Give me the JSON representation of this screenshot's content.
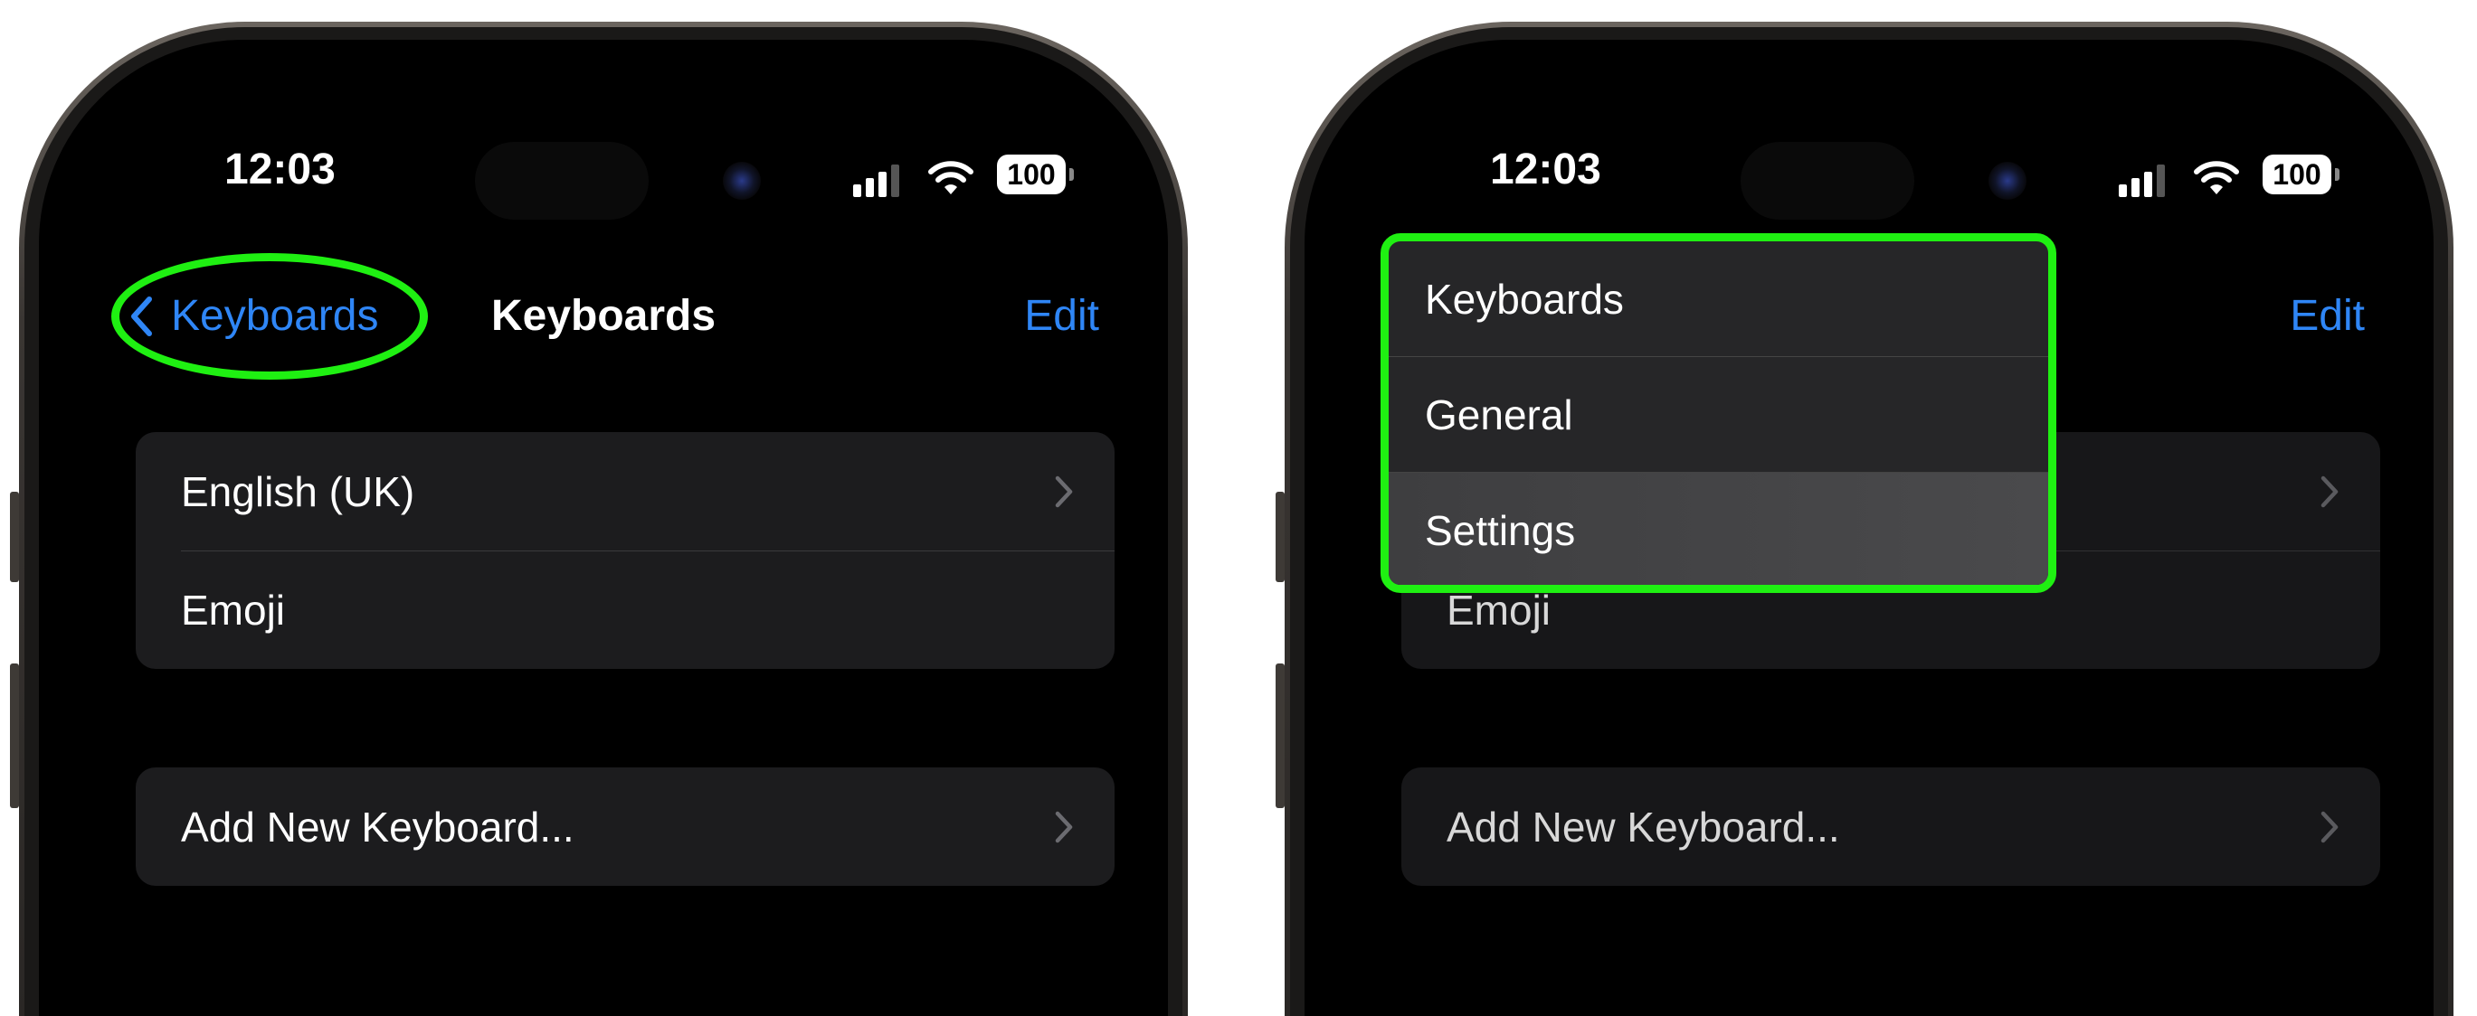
{
  "status_bar": {
    "time": "12:03",
    "battery": "100"
  },
  "nav": {
    "back_label": "Keyboards",
    "title": "Keyboards",
    "edit_label": "Edit"
  },
  "keyboards": [
    {
      "label": "English (UK)",
      "chevron": true
    },
    {
      "label": "Emoji",
      "chevron": false
    }
  ],
  "add_keyboard": {
    "label": "Add New Keyboard..."
  },
  "back_menu": {
    "items": [
      {
        "label": "Keyboards"
      },
      {
        "label": "General"
      },
      {
        "label": "Settings",
        "highlighted": true
      }
    ]
  },
  "colors": {
    "accent": "#2f86f6",
    "annotation": "#1ff012",
    "cell": "#1c1c1e"
  }
}
